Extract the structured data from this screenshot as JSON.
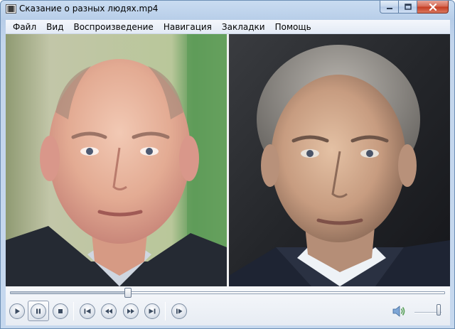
{
  "window": {
    "title": "Сказание о разных людях.mp4",
    "icons": {
      "app": "media-player-icon",
      "minimize": "minimize-icon",
      "maximize": "maximize-icon",
      "close": "close-icon"
    }
  },
  "menu": [
    "Файл",
    "Вид",
    "Воспроизведение",
    "Навигация",
    "Закладки",
    "Помощь"
  ],
  "video": {
    "content": "video-frame",
    "panels": [
      "left-face-photo",
      "right-face-photo"
    ]
  },
  "playback": {
    "progress_fraction": 0.27,
    "volume_fraction": 0.9
  },
  "controls": [
    {
      "name": "play-button",
      "icon": "play-icon"
    },
    {
      "name": "pause-button",
      "icon": "pause-icon"
    },
    {
      "name": "stop-button",
      "icon": "stop-icon"
    },
    {
      "name": "previous-button",
      "icon": "skip-back-icon"
    },
    {
      "name": "rewind-button",
      "icon": "rewind-icon"
    },
    {
      "name": "fast-forward-button",
      "icon": "fast-forward-icon"
    },
    {
      "name": "next-button",
      "icon": "skip-forward-icon"
    },
    {
      "name": "frame-step-button",
      "icon": "frame-step-icon"
    },
    {
      "name": "mute-button",
      "icon": "speaker-icon"
    }
  ],
  "colors": {
    "accent": "#3c4c62",
    "title_bar": "#c3d5ec",
    "close_button": "#c43a20"
  }
}
